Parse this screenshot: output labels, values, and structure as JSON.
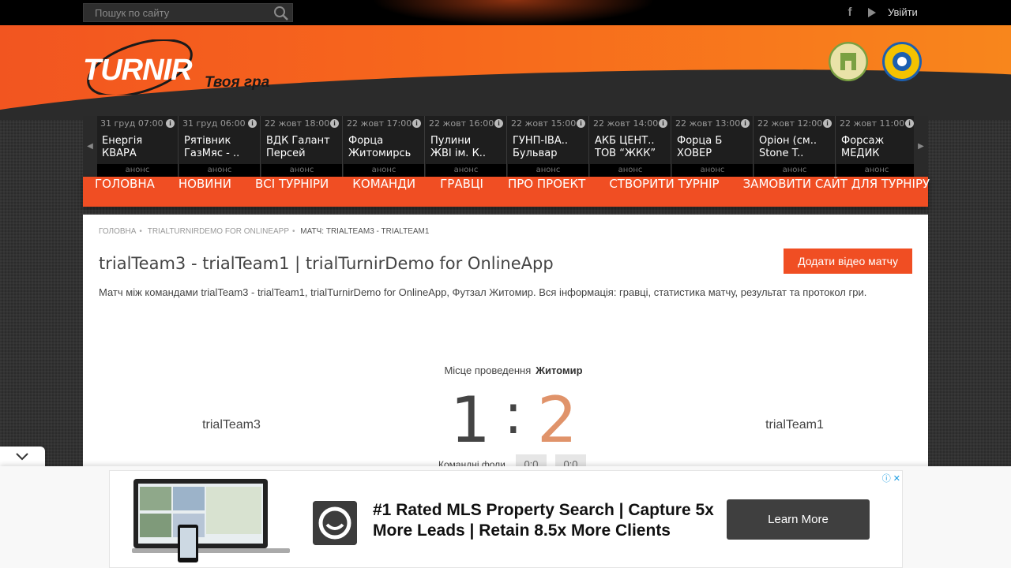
{
  "topbar": {
    "search_placeholder": "Пошук по сайту",
    "login": "Увійти"
  },
  "header": {
    "logo": "TURNIR",
    "slogan": "Твоя гра"
  },
  "ticker": [
    {
      "date": "31 груд 07:00",
      "team1": "Енергія",
      "team2": "КВАРА",
      "status": "анонс"
    },
    {
      "date": "31 груд 06:00",
      "team1": "Рятівник",
      "team2": "ГазМяс - ..",
      "status": "анонс"
    },
    {
      "date": "22 жовт 18:00",
      "team1": "ВДК Галант",
      "team2": "Персей",
      "status": "анонс"
    },
    {
      "date": "22 жовт 17:00",
      "team1": "Форца",
      "team2": "Житомирсь",
      "status": "анонс"
    },
    {
      "date": "22 жовт 16:00",
      "team1": "Пулини",
      "team2": "ЖВІ ім. К..",
      "status": "анонс"
    },
    {
      "date": "22 жовт 15:00",
      "team1": "ГУНП-ІВА..",
      "team2": "Бульвар",
      "status": "анонс"
    },
    {
      "date": "22 жовт 14:00",
      "team1": "АКБ ЦЕНТ..",
      "team2": "ТОВ “ЖКК”",
      "status": "анонс"
    },
    {
      "date": "22 жовт 13:00",
      "team1": "Форца Б",
      "team2": "ХОВЕР",
      "status": "анонс"
    },
    {
      "date": "22 жовт 12:00",
      "team1": "Оріон (см..",
      "team2": "Stone T..",
      "status": "анонс"
    },
    {
      "date": "22 жовт 11:00",
      "team1": "Форсаж",
      "team2": "МЕДИК",
      "status": "анонс"
    }
  ],
  "nav": [
    "ГОЛОВНА",
    "НОВИНИ",
    "ВСІ ТУРНІРИ",
    "КОМАНДИ",
    "ГРАВЦІ",
    "ПРО ПРОЕКТ",
    "СТВОРИТИ ТУРНІР",
    "ЗАМОВИТИ САЙТ ДЛЯ ТУРНІРУ"
  ],
  "breadcrumb": [
    "ГОЛОВНА",
    "TRIALTURNIRDEMO FOR ONLINEAPP",
    "МАТЧ: TRIALTEAM3 - TRIALTEAM1"
  ],
  "match": {
    "title": "trialTeam3 - trialTeam1 | trialTurnirDemo for OnlineApp",
    "add_video": "Додати відео матчу",
    "description": "Матч між командами trialTeam3 - trialTeam1, trialTurnirDemo for OnlineApp, Футзал Житомир. Вся інформація: гравці, статистика матчу, результат та протокол гри.",
    "venue_label": "Місце проведення",
    "venue": "Житомир",
    "team_home": "trialTeam3",
    "team_away": "trialTeam1",
    "score_home": "1",
    "separator": ":",
    "score_away": "2",
    "fouls_label": "Командні фоли",
    "fouls_home": "0:0",
    "fouls_away": "0:0"
  },
  "ad": {
    "headline": "#1 Rated MLS Property Search | Capture 5x More Leads | Retain 8.5x More Clients",
    "cta": "Learn More"
  },
  "colors": {
    "accent": "#f04e23",
    "score_away": "#e0936a"
  }
}
